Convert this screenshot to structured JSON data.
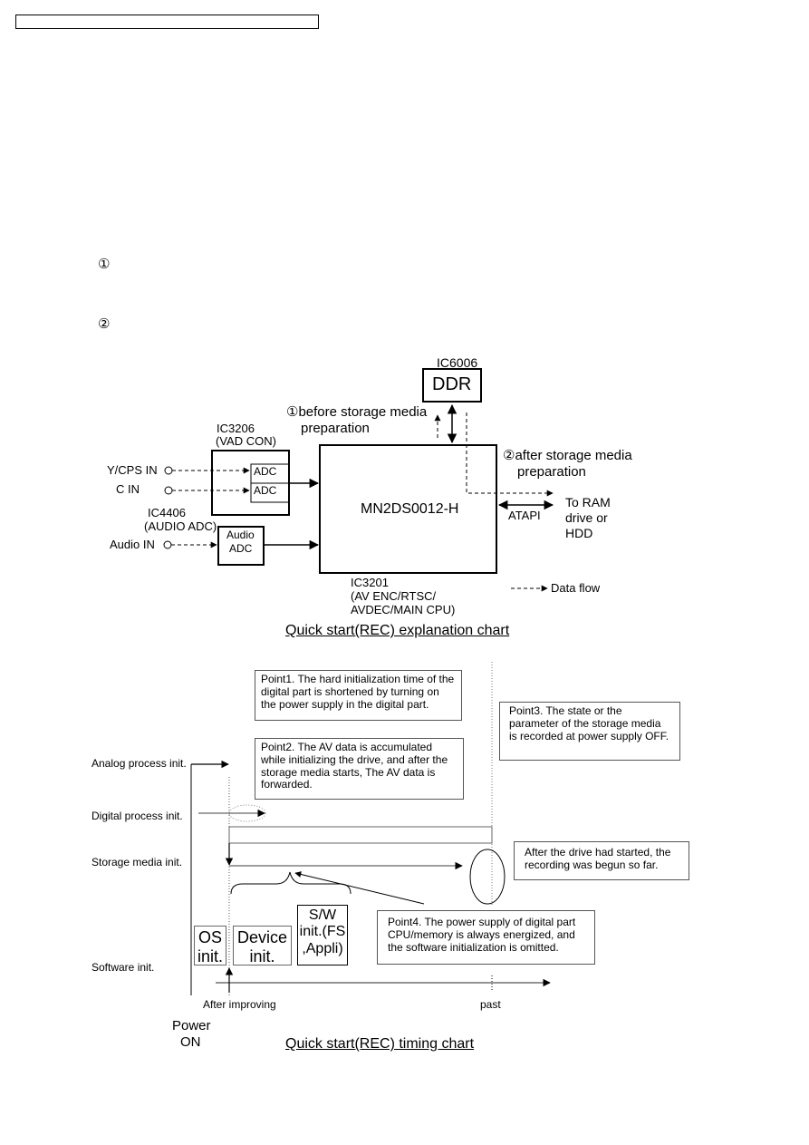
{
  "header": {
    "title_box_text": ""
  },
  "intro_markers": [
    {
      "symbol": "①"
    },
    {
      "symbol": "②"
    }
  ],
  "explanation_chart": {
    "caption": "Quick start(REC) explanation chart",
    "ddr": {
      "ic_label": "IC6006",
      "name": "DDR"
    },
    "main_ic": {
      "name": "MN2DS0012-H",
      "ic_label": "IC3201",
      "desc_line1": "(AV ENC/RTSC/",
      "desc_line2": "AVDEC/MAIN CPU)"
    },
    "vad_con": {
      "ic_label": "IC3206",
      "desc": "(VAD CON)",
      "adc1": "ADC",
      "adc2": "ADC"
    },
    "audio_adc": {
      "ic_label": "IC4406",
      "desc": "(AUDIO ADC)",
      "line1": "Audio",
      "line2": "ADC"
    },
    "inputs": [
      "Y/CPS IN",
      "C IN",
      "Audio IN"
    ],
    "before_label": {
      "symbol": "①",
      "line1": "before storage media",
      "line2": "preparation"
    },
    "after_label": {
      "symbol": "②",
      "line1": "after storage media",
      "line2": "preparation"
    },
    "atapi_label": "ATAPI",
    "destination": [
      "To RAM",
      "drive or",
      "HDD"
    ],
    "legend": {
      "label": "Data flow",
      "style": "dashed-arrow"
    }
  },
  "timing_chart": {
    "caption": "Quick start(REC) timing chart",
    "rows": [
      "Analog process init.",
      "Digital process init.",
      "Storage media init.",
      "Software init."
    ],
    "points": [
      {
        "id": "point1",
        "text": "Point1. The hard initialization time of the digital part is shortened by turning on the power supply in the digital part."
      },
      {
        "id": "point2",
        "text": "Point2. The AV data is accumulated while initializing the drive, and after the storage media starts, The AV data is forwarded."
      },
      {
        "id": "point3",
        "text": "Point3. The state or the parameter of the storage media is recorded at power supply OFF."
      },
      {
        "id": "point4",
        "text": "Point4. The power supply of digital part CPU/memory is always energized, and the software initialization is omitted."
      }
    ],
    "drive_note": "After the drive had started, the recording was begun so far.",
    "software_blocks": [
      {
        "line1": "OS",
        "line2": "init."
      },
      {
        "line1": "Device",
        "line2": "init."
      },
      {
        "line1": "S/W",
        "line2": "init.(FS",
        "line3": ",Appli)"
      }
    ],
    "axis_labels": {
      "after": "After improving",
      "past": "past"
    },
    "power_on": {
      "line1": "Power",
      "line2": "ON"
    }
  }
}
